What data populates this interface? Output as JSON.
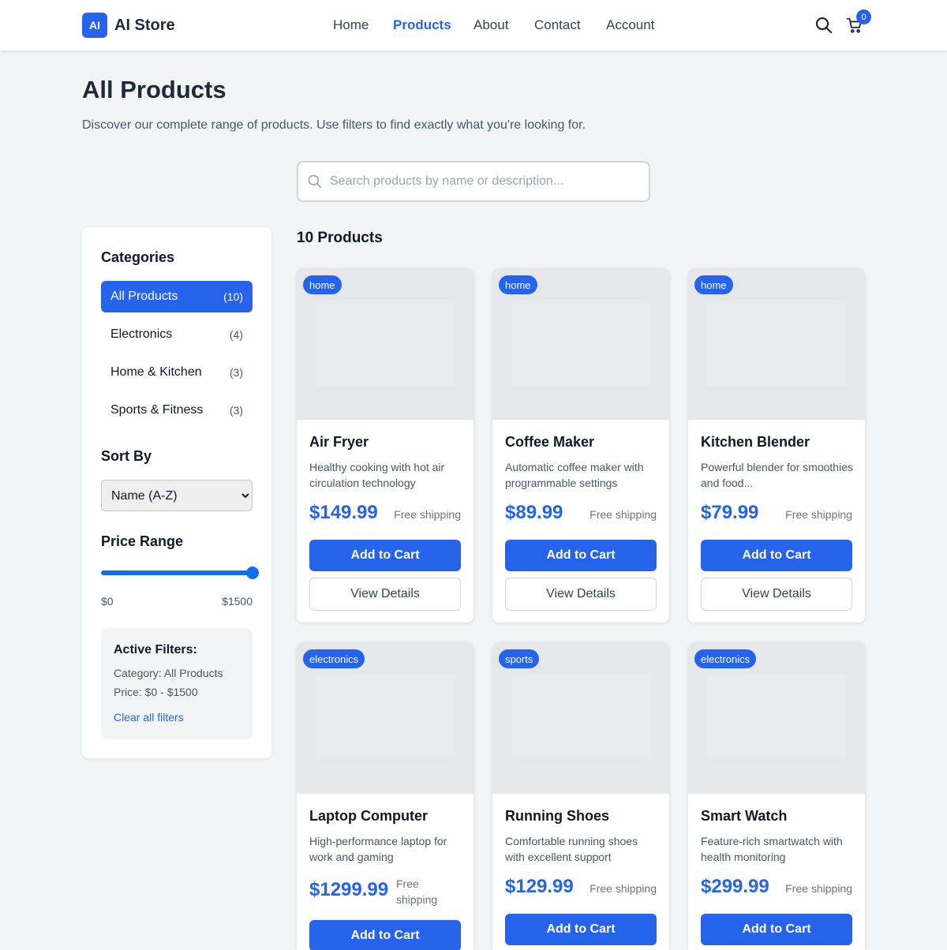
{
  "header": {
    "logo_badge": "AI",
    "logo_text": "AI Store",
    "nav": [
      "Home",
      "Products",
      "About",
      "Contact",
      "Account"
    ],
    "active_nav": "Products",
    "cart_count": "0",
    "icons": [
      "search-icon",
      "cart-icon"
    ]
  },
  "page": {
    "title": "All Products",
    "subtitle": "Discover our complete range of products. Use filters to find exactly what you're looking for."
  },
  "search": {
    "placeholder": "Search products by name or description...",
    "value": ""
  },
  "sidebar": {
    "categories_heading": "Categories",
    "categories": [
      {
        "label": "All Products",
        "count": "(10)",
        "active": true
      },
      {
        "label": "Electronics",
        "count": "(4)",
        "active": false
      },
      {
        "label": "Home & Kitchen",
        "count": "(3)",
        "active": false
      },
      {
        "label": "Sports & Fitness",
        "count": "(3)",
        "active": false
      }
    ],
    "sort_heading": "Sort By",
    "sort_selected": "Name (A-Z)",
    "price_heading": "Price Range",
    "price_min_label": "$0",
    "price_max_label": "$1500",
    "price_range_fraction": 1.0,
    "active_filters": {
      "title": "Active Filters:",
      "category": "Category: All Products",
      "price": "Price: $0 - $1500",
      "clear": "Clear all filters"
    }
  },
  "products": {
    "count_label": "10 Products",
    "add_label": "Add to Cart",
    "details_label": "View Details",
    "items": [
      {
        "badge": "home",
        "name": "Air Fryer",
        "desc": "Healthy cooking with hot air circulation technology",
        "price": "$149.99",
        "shipping": "Free shipping"
      },
      {
        "badge": "home",
        "name": "Coffee Maker",
        "desc": "Automatic coffee maker with programmable settings",
        "price": "$89.99",
        "shipping": "Free shipping"
      },
      {
        "badge": "home",
        "name": "Kitchen Blender",
        "desc": "Powerful blender for smoothies and food...",
        "price": "$79.99",
        "shipping": "Free shipping"
      },
      {
        "badge": "electronics",
        "name": "Laptop Computer",
        "desc": "High-performance laptop for work and gaming",
        "price": "$1299.99",
        "shipping": "Free shipping"
      },
      {
        "badge": "sports",
        "name": "Running Shoes",
        "desc": "Comfortable running shoes with excellent support",
        "price": "$129.99",
        "shipping": "Free shipping"
      },
      {
        "badge": "electronics",
        "name": "Smart Watch",
        "desc": "Feature-rich smartwatch with health monitoring",
        "price": "$299.99",
        "shipping": "Free shipping"
      }
    ]
  },
  "colors": {
    "accent": "#2563eb",
    "background": "#f3f4f6",
    "slider": "#0b6fef"
  }
}
